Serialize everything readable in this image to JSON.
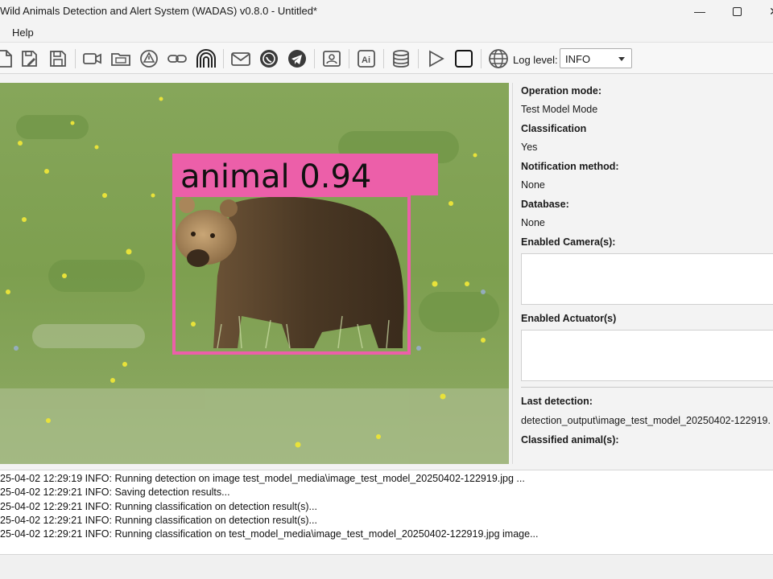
{
  "window": {
    "title": "Wild Animals Detection and Alert System (WADAS)  v0.8.0 - Untitled*",
    "minimize": "—",
    "close": "✕"
  },
  "menu": {
    "items": [
      "Help"
    ]
  },
  "toolbar": {
    "icons": [
      "open-file-icon",
      "save-as-icon",
      "save-icon",
      "camera-icon",
      "folder-icon",
      "warning-icon",
      "link-icon",
      "tunnel-icon",
      "email-icon",
      "whatsapp-icon",
      "telegram-icon",
      "contact-card-icon",
      "ai-icon",
      "database-icon",
      "play-icon",
      "stop-icon",
      "globe-icon"
    ],
    "log_level_label": "Log level:",
    "log_level_value": "INFO"
  },
  "detection": {
    "label": "animal 0.94",
    "box_color": "#ec5fa9"
  },
  "panel": {
    "operation_mode_label": "Operation mode:",
    "operation_mode_value": "Test Model Mode",
    "classification_label": "Classification",
    "classification_value": "Yes",
    "notification_label": "Notification method:",
    "notification_value": "None",
    "database_label": "Database:",
    "database_value": "None",
    "cameras_label": "Enabled Camera(s):",
    "actuators_label": "Enabled Actuator(s)",
    "last_detection_label": "Last detection:",
    "last_detection_value": "detection_output\\image_test_model_20250402-122919.",
    "classified_label": "Classified animal(s):"
  },
  "log": {
    "lines": [
      "25-04-02 12:29:19 INFO: Running detection on image test_model_media\\image_test_model_20250402-122919.jpg ...",
      "25-04-02 12:29:21 INFO: Saving detection results...",
      "25-04-02 12:29:21 INFO: Running classification on detection result(s)...",
      "25-04-02 12:29:21 INFO: Running classification on detection result(s)...",
      "25-04-02 12:29:21 INFO: Running classification on test_model_media\\image_test_model_20250402-122919.jpg image..."
    ]
  }
}
